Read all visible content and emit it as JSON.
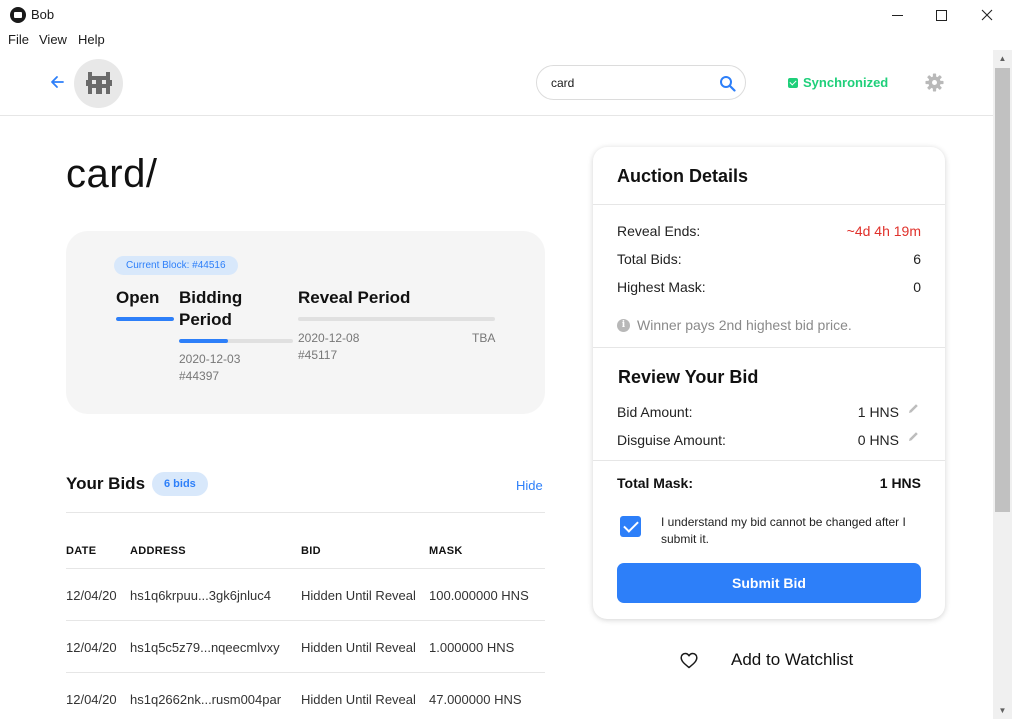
{
  "window": {
    "title": "Bob",
    "menu": [
      "File",
      "View",
      "Help"
    ]
  },
  "header": {
    "search_value": "card",
    "sync_status": "Synchronized",
    "colors": {
      "accent": "#2d7ff9",
      "sync": "#1fcf7a"
    }
  },
  "domain": {
    "title": "card/"
  },
  "timeline": {
    "current_block": "Current Block: #44516",
    "phases": [
      {
        "label": "Open",
        "progress": 1.0
      },
      {
        "label": "Bidding Period",
        "progress": 0.43,
        "date": "2020-12-03",
        "block": "#44397"
      },
      {
        "label": "Reveal Period",
        "progress": 0.0,
        "date": "2020-12-08",
        "block": "#45117",
        "end": "TBA"
      }
    ]
  },
  "bids": {
    "title": "Your Bids",
    "badge": "6 bids",
    "hide_label": "Hide",
    "columns": [
      "DATE",
      "ADDRESS",
      "BID",
      "MASK"
    ],
    "rows": [
      {
        "date": "12/04/20",
        "address": "hs1q6krpuu...3gk6jnluc4",
        "bid": "Hidden Until Reveal",
        "mask": "100.000000 HNS"
      },
      {
        "date": "12/04/20",
        "address": "hs1q5c5z79...nqeecmlvxy",
        "bid": "Hidden Until Reveal",
        "mask": "1.000000 HNS"
      },
      {
        "date": "12/04/20",
        "address": "hs1q2662nk...rusm004par",
        "bid": "Hidden Until Reveal",
        "mask": "47.000000 HNS"
      }
    ]
  },
  "auction": {
    "title": "Auction Details",
    "reveal_ends_label": "Reveal Ends:",
    "reveal_ends_value": "~4d 4h 19m",
    "total_bids_label": "Total Bids:",
    "total_bids_value": "6",
    "highest_mask_label": "Highest Mask:",
    "highest_mask_value": "0",
    "note": "Winner pays 2nd highest bid price.",
    "review_title": "Review Your Bid",
    "bid_amount_label": "Bid Amount:",
    "bid_amount_value": "1 HNS",
    "disguise_label": "Disguise Amount:",
    "disguise_value": "0 HNS",
    "total_mask_label": "Total Mask:",
    "total_mask_value": "1 HNS",
    "agree_text": "I understand my bid cannot be changed after I submit it.",
    "submit_label": "Submit Bid",
    "reveal_color": "#e0312b"
  },
  "watchlist": {
    "label": "Add to Watchlist"
  },
  "icons": {
    "app": "bob-logo-icon",
    "back": "arrow-left-icon",
    "search": "search-icon",
    "settings": "gear-icon",
    "info": "info-icon",
    "edit": "pencil-icon",
    "watch": "heart-icon"
  }
}
